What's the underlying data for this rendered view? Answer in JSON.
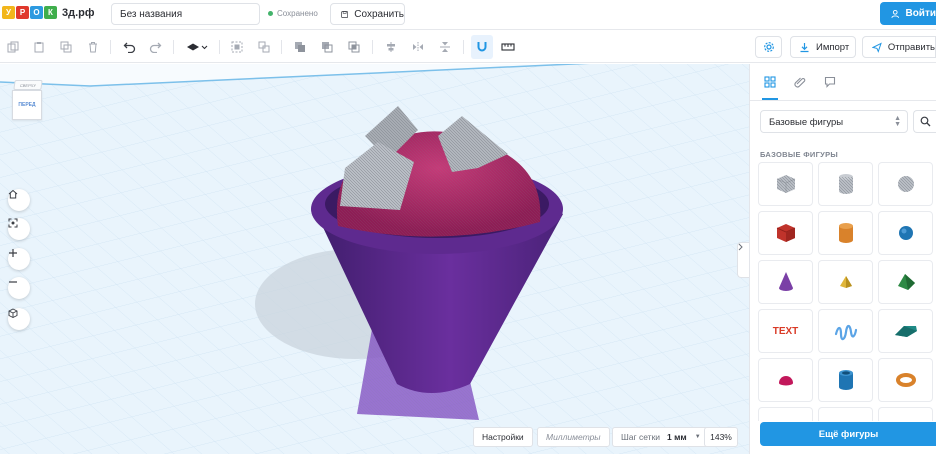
{
  "header": {
    "logo_letters": [
      "У",
      "Р",
      "О",
      "К"
    ],
    "logo_colors": [
      "#f2b61b",
      "#e0382c",
      "#2d9ae0",
      "#3fae4c"
    ],
    "brand": "3д.рф",
    "document_name": "Без названия",
    "save_status": "Сохранено",
    "save_label": "Сохранить",
    "login_label": "Войти"
  },
  "toolbar": {
    "icons": [
      "copy-icon",
      "paste-icon",
      "duplicate-icon",
      "delete-icon",
      "undo-icon",
      "redo-icon",
      "workplane-icon",
      "group-icon",
      "ungroup-icon",
      "solid-icon",
      "hole-icon",
      "intersect-icon",
      "align-icon",
      "mirror-icon",
      "flip-icon",
      "magnet-icon",
      "ruler-icon"
    ],
    "import_label": "Импорт",
    "send_label": "Отправить"
  },
  "canvas": {
    "viewcube_top": "СВЕРХУ",
    "viewcube_front": "ПЕРЕД",
    "nav_buttons": [
      "home-icon",
      "fit-view-icon",
      "zoom-in-icon",
      "zoom-out-icon",
      "perspective-icon"
    ],
    "settings_label": "Настройки",
    "units_label": "Миллиметры",
    "grid_step_label": "Шаг сетки",
    "grid_step_value": "1 мм",
    "zoom": "143%"
  },
  "panel": {
    "tabs": [
      "shapes-tab-icon",
      "attach-tab-icon",
      "chat-tab-icon"
    ],
    "category": "Базовые фигуры",
    "section_title": "БАЗОВЫЕ ФИГУРЫ",
    "text_shape_label": "TEXT",
    "shapes": [
      {
        "name": "hole-box",
        "color": "#b8bdc4"
      },
      {
        "name": "hole-cylinder",
        "color": "#b8bdc4"
      },
      {
        "name": "hole-sphere",
        "color": "#b8bdc4"
      },
      {
        "name": "box",
        "color": "#c0332b"
      },
      {
        "name": "cylinder",
        "color": "#d9822b"
      },
      {
        "name": "sphere",
        "color": "#1f75b3"
      },
      {
        "name": "cone",
        "color": "#7a3fa6"
      },
      {
        "name": "pyramid",
        "color": "#e0b63a"
      },
      {
        "name": "roof",
        "color": "#2d8a45"
      },
      {
        "name": "text",
        "color": "#d93a26"
      },
      {
        "name": "scribble",
        "color": "#5ba4e6"
      },
      {
        "name": "wedge",
        "color": "#1f8a86"
      },
      {
        "name": "half-sphere",
        "color": "#c2185b"
      },
      {
        "name": "tube",
        "color": "#1f75b3"
      },
      {
        "name": "torus",
        "color": "#d9822b"
      }
    ],
    "more_label": "Ещё фигуры"
  }
}
